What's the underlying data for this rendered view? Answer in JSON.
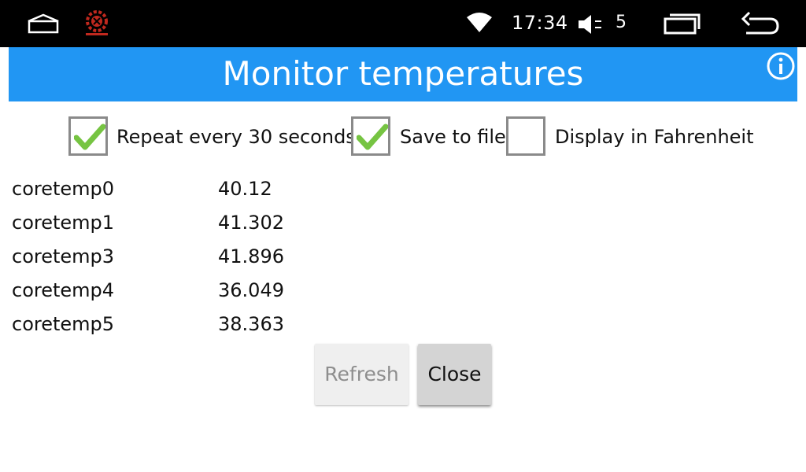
{
  "status_bar": {
    "time": "17:34",
    "volume_level": "5",
    "icons": [
      "home-icon",
      "app-logo-icon",
      "wifi-icon",
      "volume-icon",
      "recent-apps-icon",
      "back-icon"
    ]
  },
  "dialog": {
    "title": "Monitor temperatures",
    "accent_color": "#2196f3"
  },
  "options": [
    {
      "label": "Repeat every 30 seconds",
      "checked": true
    },
    {
      "label": "Save to file",
      "checked": true
    },
    {
      "label": "Display in Fahrenheit",
      "checked": false
    }
  ],
  "temperatures": [
    {
      "name": "coretemp0",
      "value": "40.12"
    },
    {
      "name": "coretemp1",
      "value": "41.302"
    },
    {
      "name": "coretemp3",
      "value": "41.896"
    },
    {
      "name": "coretemp4",
      "value": "36.049"
    },
    {
      "name": "coretemp5",
      "value": "38.363"
    }
  ],
  "buttons": {
    "refresh_label": "Refresh",
    "refresh_enabled": false,
    "close_label": "Close"
  }
}
